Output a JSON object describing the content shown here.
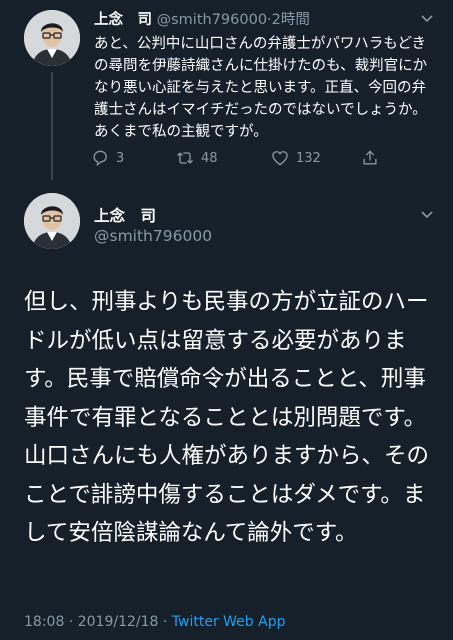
{
  "reply": {
    "name": "上念　司",
    "handle": "@smith796000",
    "time": "2時間",
    "text": "あと、公判中に山口さんの弁護士がパワハラもどきの尋問を伊藤詩織さんに仕掛けたのも、裁判官にかなり悪い心証を与えたと思います。正直、今回の弁護士さんはイマイチだったのではないでしょうか。あくまで私の主観ですが。",
    "reply_count": "3",
    "retweet_count": "48",
    "like_count": "132"
  },
  "main": {
    "name": "上念　司",
    "handle": "@smith796000",
    "text": "但し、刑事よりも民事の方が立証のハードルが低い点は留意する必要があります。民事で賠償命令が出ることと、刑事事件で有罪となることとは別問題です。山口さんにも人権がありますから、そのことで誹謗中傷することはダメです。まして安倍陰謀論なんて論外です。",
    "time": "18:08",
    "date": "2019/12/18",
    "separator": "·",
    "source": "Twitter Web App"
  },
  "colors": {
    "background": "#15202b",
    "muted": "#8899a6",
    "link": "#1da1f2"
  },
  "icons": [
    "avatar-photo",
    "chevron-down-icon",
    "reply-icon",
    "retweet-icon",
    "like-icon",
    "share-icon"
  ]
}
